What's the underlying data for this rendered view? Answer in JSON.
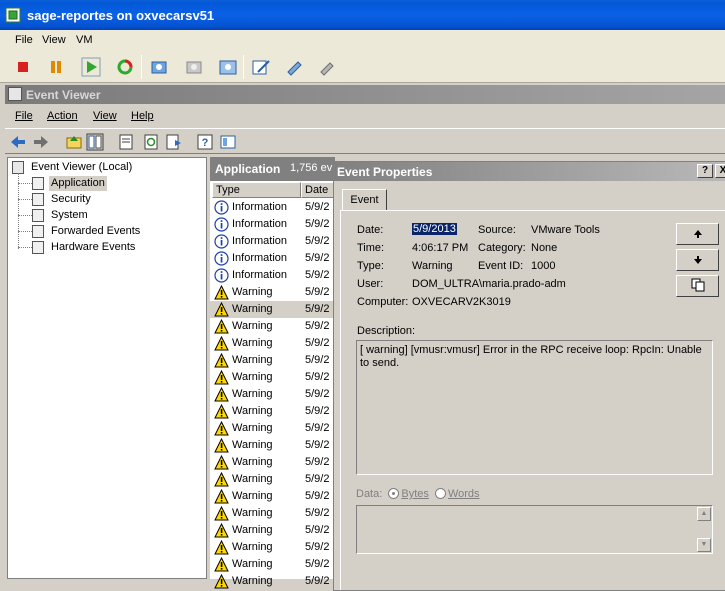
{
  "vmware": {
    "title": "sage-reportes on oxvecarsv51",
    "menu": [
      "File",
      "View",
      "VM"
    ],
    "toolbar_icons": [
      "stop-icon",
      "pause-icon",
      "play-icon",
      "reset-icon",
      "snapshot-icon",
      "revert-snapshot-icon",
      "snapshot-manager-icon",
      "edit-settings-icon",
      "tools-icon",
      "disconnect-icon"
    ]
  },
  "event_viewer": {
    "title": "Event Viewer",
    "menu": [
      "File",
      "Action",
      "View",
      "Help"
    ],
    "tree": {
      "root": "Event Viewer (Local)",
      "items": [
        "Application",
        "Security",
        "System",
        "Forwarded Events",
        "Hardware Events"
      ],
      "selected": "Application"
    },
    "list": {
      "title": "Application",
      "count": "1,756 ev",
      "columns": [
        "Type",
        "Date"
      ],
      "rows": [
        {
          "type": "Information",
          "date": "5/9/2"
        },
        {
          "type": "Information",
          "date": "5/9/2"
        },
        {
          "type": "Information",
          "date": "5/9/2"
        },
        {
          "type": "Information",
          "date": "5/9/2"
        },
        {
          "type": "Information",
          "date": "5/9/2"
        },
        {
          "type": "Warning",
          "date": "5/9/2"
        },
        {
          "type": "Warning",
          "date": "5/9/2"
        },
        {
          "type": "Warning",
          "date": "5/9/2"
        },
        {
          "type": "Warning",
          "date": "5/9/2"
        },
        {
          "type": "Warning",
          "date": "5/9/2"
        },
        {
          "type": "Warning",
          "date": "5/9/2"
        },
        {
          "type": "Warning",
          "date": "5/9/2"
        },
        {
          "type": "Warning",
          "date": "5/9/2"
        },
        {
          "type": "Warning",
          "date": "5/9/2"
        },
        {
          "type": "Warning",
          "date": "5/9/2"
        },
        {
          "type": "Warning",
          "date": "5/9/2"
        },
        {
          "type": "Warning",
          "date": "5/9/2"
        },
        {
          "type": "Warning",
          "date": "5/9/2"
        },
        {
          "type": "Warning",
          "date": "5/9/2"
        },
        {
          "type": "Warning",
          "date": "5/9/2"
        },
        {
          "type": "Warning",
          "date": "5/9/2"
        },
        {
          "type": "Warning",
          "date": "5/9/2"
        },
        {
          "type": "Warning",
          "date": "5/9/2"
        }
      ],
      "selected_index": 6
    }
  },
  "dialog": {
    "title": "Event Properties",
    "help_button": "?",
    "close_button": "X",
    "tab": "Event",
    "date_label": "Date:",
    "date_value": "5/9/2013",
    "source_label": "Source:",
    "source_value": "VMware Tools",
    "time_label": "Time:",
    "time_value": "4:06:17 PM",
    "category_label": "Category:",
    "category_value": "None",
    "type_label": "Type:",
    "type_value": "Warning",
    "event_id_label": "Event ID:",
    "event_id_value": "1000",
    "user_label": "User:",
    "user_value": "DOM_ULTRA\\maria.prado-adm",
    "computer_label": "Computer:",
    "computer_value": "OXVECARV2K3019",
    "description_label": "Description:",
    "description_text": "[ warning] [vmusr:vmusr] Error in the RPC receive loop: RpcIn: Unable to send.",
    "data_label": "Data:",
    "bytes_label": "Bytes",
    "words_label": "Words",
    "data_format_selected": "Bytes",
    "side_buttons": [
      "up-arrow-icon",
      "down-arrow-icon",
      "copy-icon"
    ]
  }
}
